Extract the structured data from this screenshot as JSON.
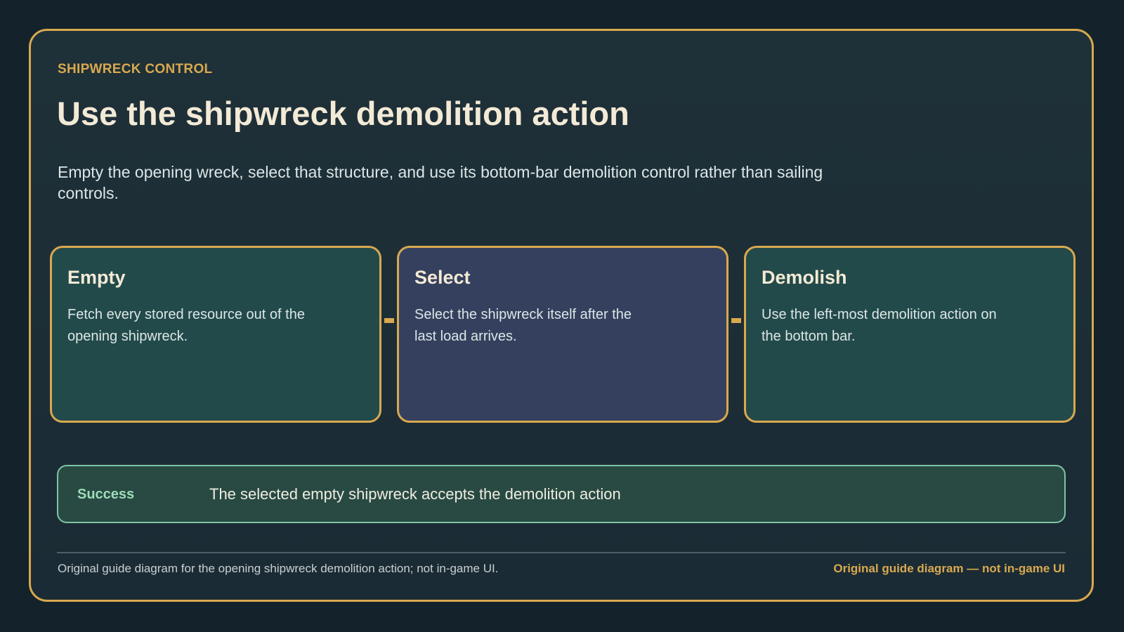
{
  "header": {
    "eyebrow": "SHIPWRECK CONTROL",
    "title": "Use the shipwreck demolition action",
    "subtitle": "Empty the opening wreck, select that structure, and use its bottom-bar demolition control rather than sailing controls."
  },
  "steps": [
    {
      "title": "Empty",
      "text": "Fetch every stored resource out of the opening shipwreck."
    },
    {
      "title": "Select",
      "text": "Select the shipwreck itself after the last load arrives."
    },
    {
      "title": "Demolish",
      "text": "Use the left-most demolition action on the bottom bar."
    }
  ],
  "success": {
    "label": "Success",
    "text": "The selected empty shipwreck accepts the demolition action"
  },
  "footer": {
    "note": "Original guide diagram for the opening shipwreck demolition action; not in-game UI.",
    "tag": "Original guide diagram — not in-game UI"
  },
  "colors": {
    "accent": "#d9a94f",
    "success": "#7ec5a4",
    "step_primary": "#234a4a",
    "step_alt": "#35405e"
  }
}
